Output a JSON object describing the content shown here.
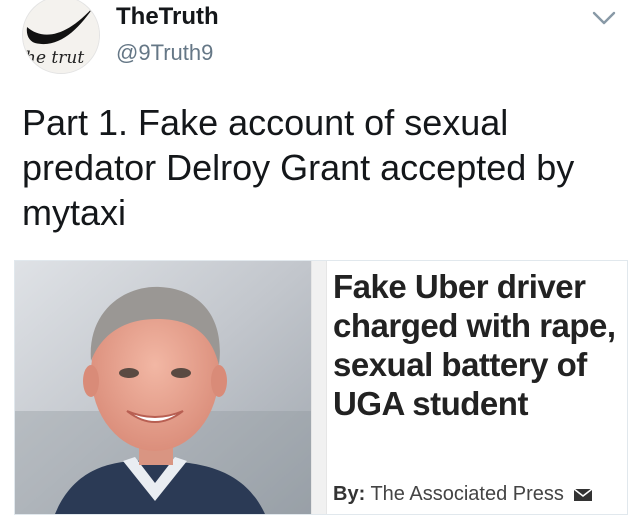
{
  "author": {
    "display_name": "TheTruth",
    "handle": "@9Truth9",
    "avatar_icon": "swoosh-logo-icon",
    "avatar_text": "he trut"
  },
  "tweet": {
    "text": "Part 1. Fake account of sexual predator Delroy Grant accepted by mytaxi"
  },
  "card": {
    "headline": "Fake Uber driver charged with rape, sexual battery of UGA student",
    "byline_label": "By:",
    "byline_name": "The Associated Press",
    "byline_icon": "envelope-icon"
  },
  "menu_icon": "chevron-down-icon",
  "colors": {
    "text": "#14171a",
    "secondary": "#657786",
    "border": "#e1e8ed"
  }
}
